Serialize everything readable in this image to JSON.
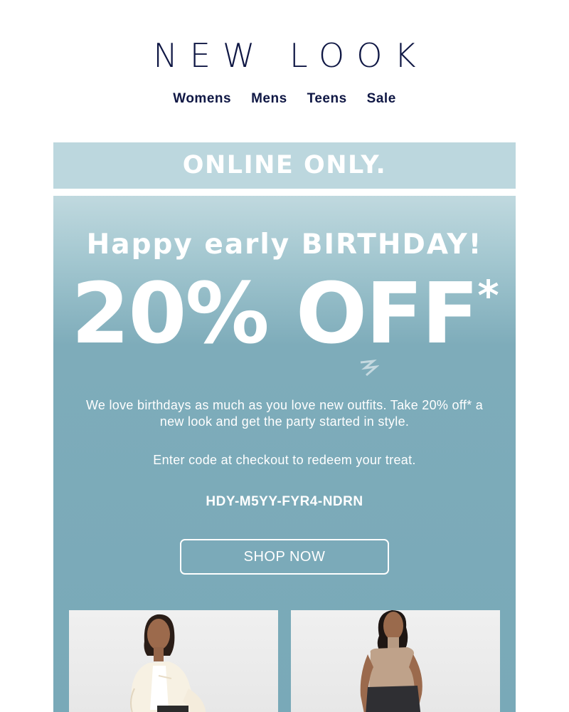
{
  "header": {
    "logo": "NEW LOOK",
    "nav": [
      "Womens",
      "Mens",
      "Teens",
      "Sale"
    ]
  },
  "banner": {
    "text": "ONLINE ONLY."
  },
  "hero": {
    "headline": "Happy early BIRTHDAY!",
    "discount": "20% OFF",
    "asterisk": "*",
    "body": "We love birthdays as much as you love new outfits. Take 20% off* a new look and get the party started in style.",
    "redeem": "Enter code at checkout to redeem your treat.",
    "code": "HDY-M5YY-FYR4-NDRN",
    "cta": "SHOP NOW"
  },
  "colors": {
    "navy": "#0f1744",
    "banner": "#bcd7de",
    "hero": "#79a9b8"
  },
  "images": [
    "model-cream-cardigan",
    "model-sleeveless-knit-top"
  ]
}
